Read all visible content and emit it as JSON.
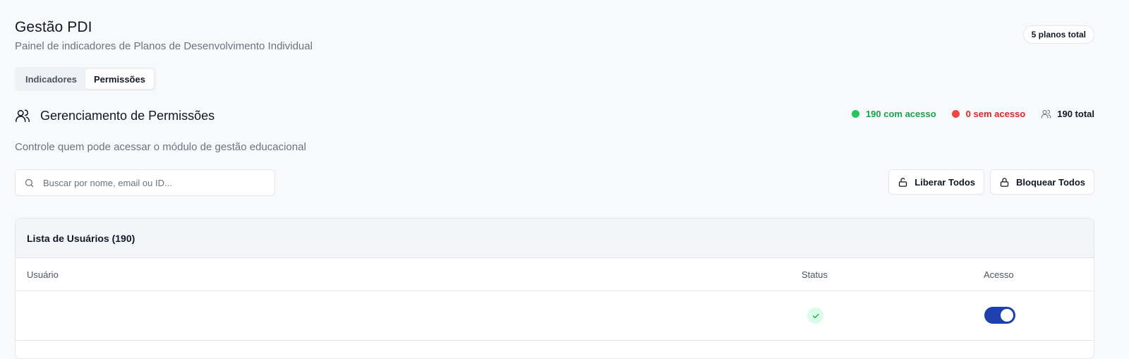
{
  "header": {
    "title": "Gestão PDI",
    "subtitle": "Painel de indicadores de Planos de Desenvolvimento Individual",
    "plans_badge": "5 planos total"
  },
  "tabs": [
    {
      "label": "Indicadores",
      "active": false
    },
    {
      "label": "Permissões",
      "active": true
    }
  ],
  "section": {
    "icon": "users-icon",
    "title": "Gerenciamento de Permissões",
    "description": "Controle quem pode acessar o módulo de gestão educacional",
    "stats": {
      "with_access": "190 com acesso",
      "without_access": "0 sem acesso",
      "total": "190 total"
    }
  },
  "search": {
    "placeholder": "Buscar por nome, email ou ID...",
    "value": ""
  },
  "actions": {
    "unlock_all": "Liberar Todos",
    "lock_all": "Bloquear Todos"
  },
  "user_list": {
    "title": "Lista de Usuários (190)",
    "columns": {
      "user": "Usuário",
      "status": "Status",
      "access": "Acesso"
    },
    "rows": [
      {
        "user": "",
        "status": "check-icon",
        "access_enabled": true
      }
    ]
  },
  "colors": {
    "green": "#16a34a",
    "red": "#dc2626",
    "toggle_on": "#1e40af",
    "background": "#f8f9fb"
  }
}
